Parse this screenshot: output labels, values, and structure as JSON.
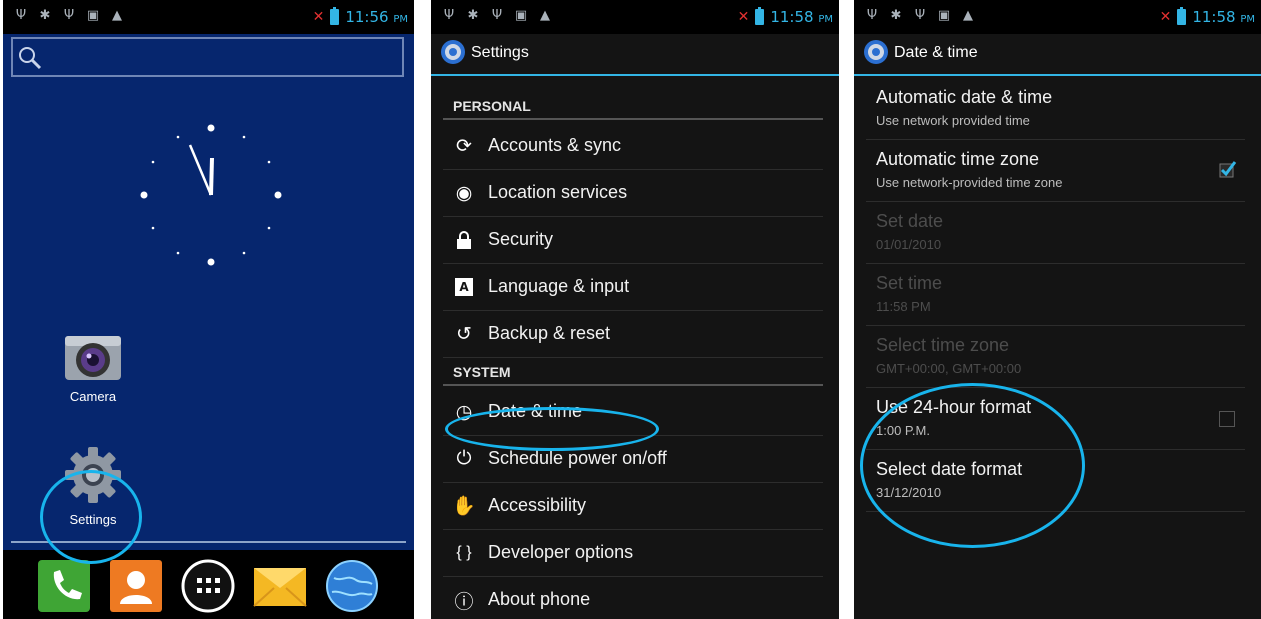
{
  "home": {
    "status": {
      "time": "11:56",
      "ampm": "PM"
    },
    "apps": [
      {
        "label": "Camera"
      },
      {
        "label": "Settings"
      }
    ]
  },
  "settings": {
    "status": {
      "time": "11:58",
      "ampm": "PM"
    },
    "title": "Settings",
    "sections": [
      {
        "header": "PERSONAL",
        "items": [
          {
            "label": "Accounts & sync",
            "icon": "sync-icon"
          },
          {
            "label": "Location services",
            "icon": "location-icon"
          },
          {
            "label": "Security",
            "icon": "lock-icon"
          },
          {
            "label": "Language & input",
            "icon": "keyboard-icon"
          },
          {
            "label": "Backup & reset",
            "icon": "backup-icon"
          }
        ]
      },
      {
        "header": "SYSTEM",
        "items": [
          {
            "label": "Date & time",
            "icon": "clock-icon"
          },
          {
            "label": "Schedule power on/off",
            "icon": "power-schedule-icon"
          },
          {
            "label": "Accessibility",
            "icon": "hand-icon"
          },
          {
            "label": "Developer options",
            "icon": "braces-icon"
          },
          {
            "label": "About phone",
            "icon": "info-icon"
          }
        ]
      }
    ]
  },
  "datetime": {
    "status": {
      "time": "11:58",
      "ampm": "PM"
    },
    "title": "Date & time",
    "items": [
      {
        "title": "Automatic date & time",
        "subtitle": "Use network provided time",
        "enabled": true
      },
      {
        "title": "Automatic time zone",
        "subtitle": "Use network-provided time zone",
        "enabled": true,
        "checked": true
      },
      {
        "title": "Set date",
        "subtitle": "01/01/2010",
        "enabled": false
      },
      {
        "title": "Set time",
        "subtitle": "11:58 PM",
        "enabled": false
      },
      {
        "title": "Select time zone",
        "subtitle": "GMT+00:00, GMT+00:00",
        "enabled": false
      },
      {
        "title": "Use 24-hour format",
        "subtitle": "1:00 P.M.",
        "enabled": true,
        "checked": false
      },
      {
        "title": "Select date format",
        "subtitle": "31/12/2010",
        "enabled": true
      }
    ]
  },
  "colors": {
    "accent": "#33b5e5",
    "highlight": "#18b4ec",
    "home_bg": "#06266e"
  }
}
